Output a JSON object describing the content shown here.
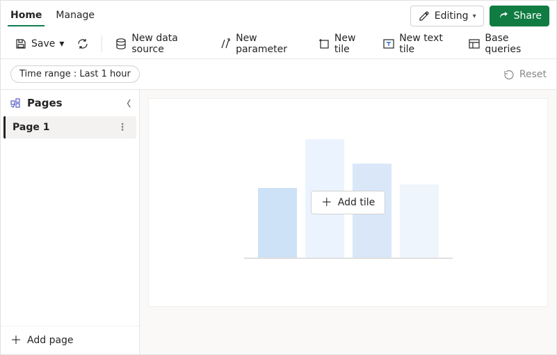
{
  "tabs": {
    "home": "Home",
    "manage": "Manage"
  },
  "topbar": {
    "editing": "Editing",
    "share": "Share"
  },
  "cmd": {
    "save": "Save",
    "new_data_source": "New data source",
    "new_parameter": "New parameter",
    "new_tile": "New tile",
    "new_text_tile": "New text tile",
    "base_queries": "Base queries"
  },
  "filter": {
    "time_label": "Time range :",
    "time_value": "Last 1 hour",
    "reset": "Reset"
  },
  "sidebar": {
    "pages_header": "Pages",
    "pages": [
      {
        "label": "Page 1"
      }
    ],
    "add_page": "Add page"
  },
  "canvas": {
    "add_tile": "Add tile"
  }
}
